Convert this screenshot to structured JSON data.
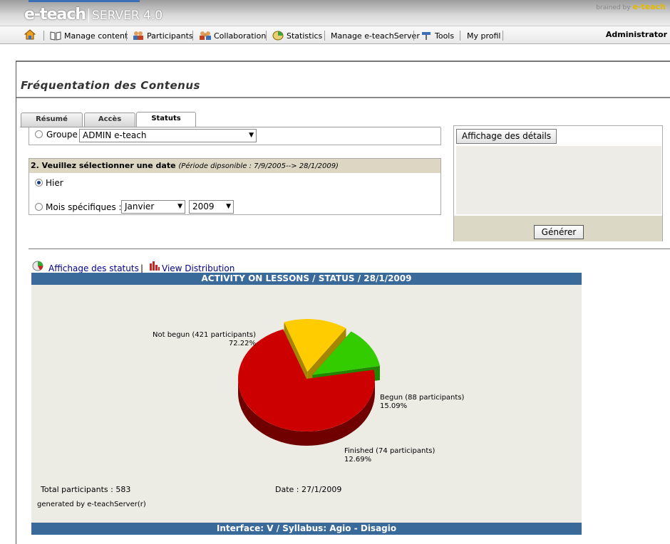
{
  "header": {
    "brand": "e-teach",
    "server": "SERVER 4.0",
    "brained_by": "brained by",
    "brained_brand": "e-teach"
  },
  "menu": {
    "items": [
      {
        "label": "Manage content",
        "icon": "book-icon"
      },
      {
        "label": "Participants",
        "icon": "people-icon"
      },
      {
        "label": "Collaboration",
        "icon": "group-icon"
      },
      {
        "label": "Statistics",
        "icon": "chart-icon"
      },
      {
        "label": "Manage e-teachServer",
        "icon": ""
      },
      {
        "label": "Tools",
        "icon": "tools-icon"
      },
      {
        "label": "My profil",
        "icon": ""
      }
    ],
    "user": "Administrator"
  },
  "page": {
    "title": "Fréquentation des Contenus",
    "tabs": [
      "Résumé",
      "Accès",
      "Statuts"
    ],
    "active_tab": "Statuts"
  },
  "form": {
    "group_label": "Groupe :",
    "group_value": "ADMIN e-teach",
    "date_heading": "2. Veuillez sélectionner une date",
    "date_period": "(Période dipsonible : 7/9/2005--> 28/1/2009)",
    "option_yesterday": "Hier",
    "option_months": "Mois spécifiques :",
    "month_value": "Janvier",
    "year_value": "2009"
  },
  "details": {
    "button_label": "Affichage des détails",
    "generate_label": "Générer"
  },
  "links": {
    "statuses": "Affichage des statuts",
    "separator": "|",
    "distribution": "View Distribution"
  },
  "chart_data": {
    "type": "pie",
    "title": "ACTIVITY ON LESSONS / STATUS / 28/1/2009",
    "slices": [
      {
        "label": "Not begun (421 participants)",
        "percent_label": "72.22%",
        "value": 421,
        "color": "#cc0000"
      },
      {
        "label": "Begun (88 participants)",
        "percent_label": "15.09%",
        "value": 88,
        "color": "#ffcc00"
      },
      {
        "label": "Finished (74 participants)",
        "percent_label": "12.69%",
        "value": 74,
        "color": "#33cc00"
      }
    ],
    "total_label": "Total participants : 583",
    "date_label": "Date : 27/1/2009",
    "generated_by": "generated by e-teachServer(r)",
    "footer": "Interface: V / Syllabus: Agio - Disagio"
  }
}
